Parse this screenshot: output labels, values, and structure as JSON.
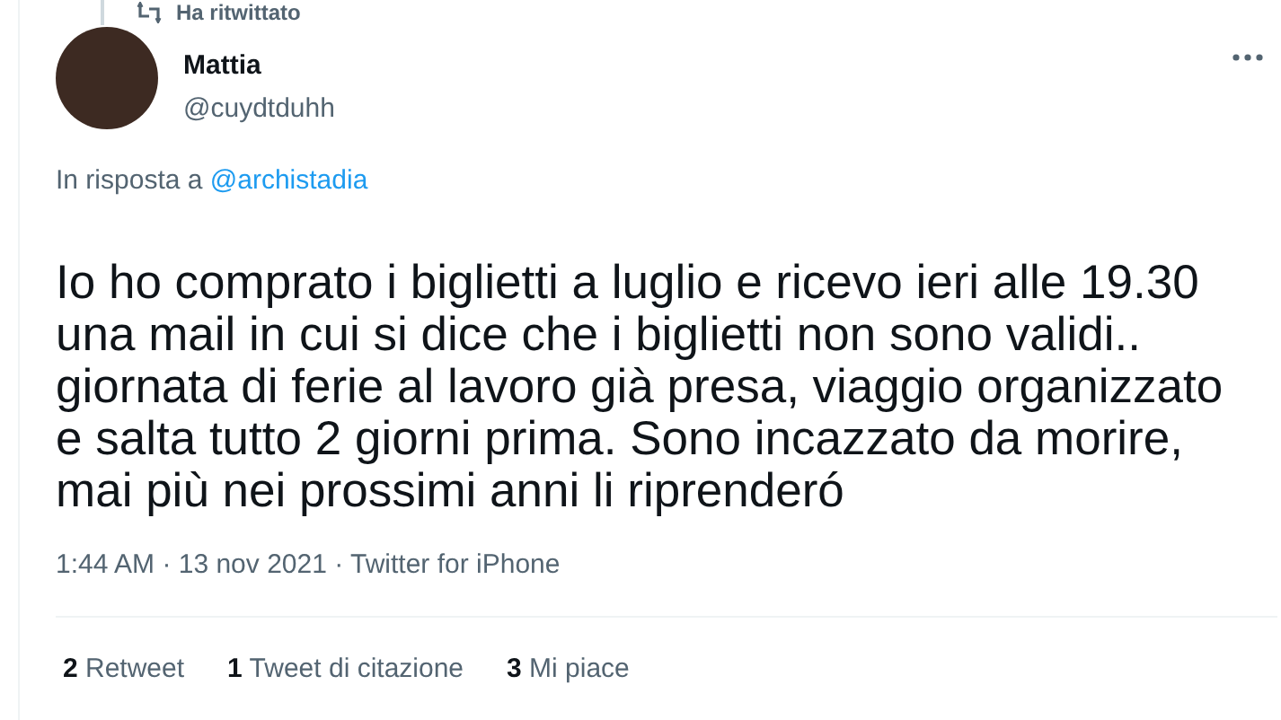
{
  "context": {
    "label": "Ha ritwittato"
  },
  "tweet": {
    "name": "Mattia",
    "handle": "@cuydtduhh",
    "reply_prefix": "In risposta a",
    "reply_to": "@archistadia",
    "text": "Io ho comprato i biglietti a luglio e ricevo ieri alle 19.30 una mail in cui si dice che i biglietti non sono validi.. giornata di ferie al lavoro già presa, viaggio organizzato e salta tutto 2 giorni prima. Sono incazzato da morire, mai più nei prossimi anni li riprenderó",
    "timestamp": "1:44 AM · 13 nov 2021 · Twitter for iPhone"
  },
  "stats": [
    {
      "count": "2",
      "label": "Retweet"
    },
    {
      "count": "1",
      "label": "Tweet di citazione"
    },
    {
      "count": "3",
      "label": "Mi piace"
    }
  ]
}
